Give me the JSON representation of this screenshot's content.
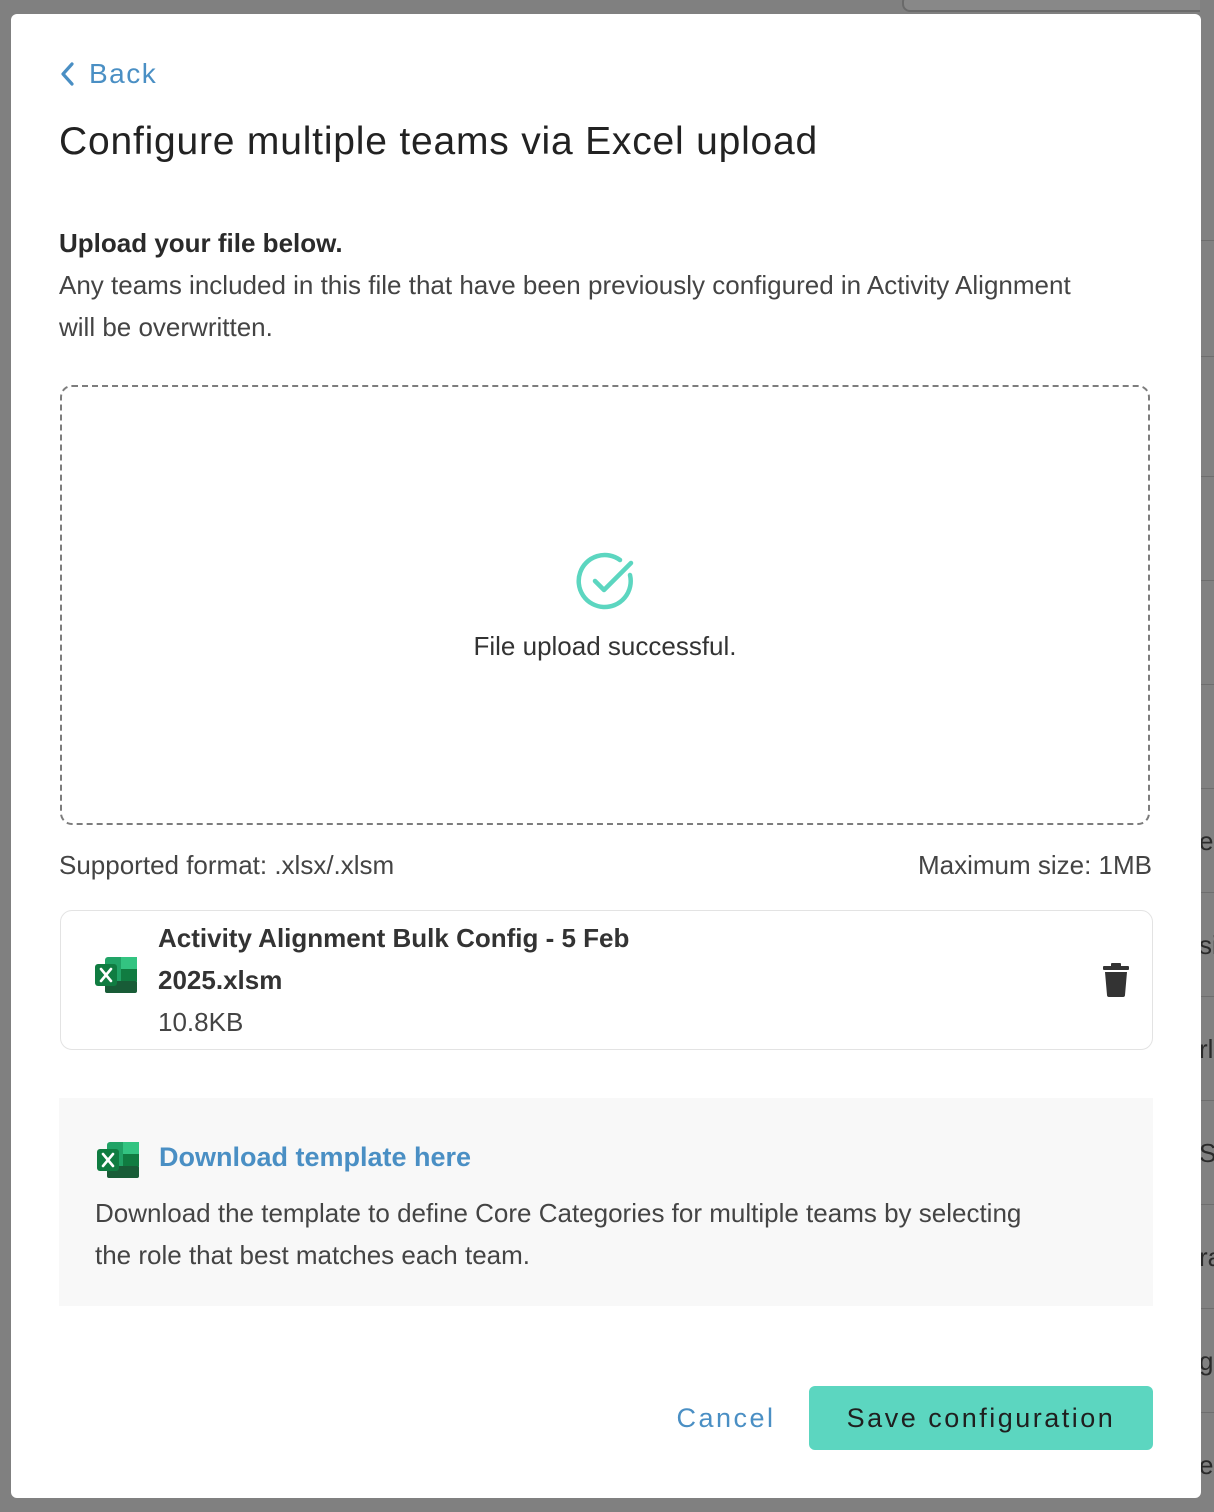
{
  "background": {
    "fragments": [
      "e",
      "si",
      "rl",
      "Se",
      "ra",
      "g",
      "e"
    ]
  },
  "modal": {
    "back_label": "Back",
    "title": "Configure multiple teams via Excel upload",
    "intro_heading": "Upload your file below.",
    "intro_text": "Any teams included in this file that have been previously configured in Activity Alignment will be overwritten.",
    "dropzone": {
      "status_icon": "check-circle-icon",
      "status_text": "File upload successful."
    },
    "supported_format": "Supported format: .xlsx/.xlsm",
    "max_size": "Maximum size: 1MB",
    "uploaded_file": {
      "icon": "excel-file-icon",
      "name": "Activity Alignment Bulk Config - 5 Feb 2025.xlsm",
      "size": "10.8KB",
      "delete_icon": "trash-icon"
    },
    "template": {
      "icon": "excel-file-icon",
      "link_label": "Download template here",
      "description": "Download the template to define Core Categories for multiple teams by selecting the role that best matches each team."
    },
    "cancel_label": "Cancel",
    "save_label": "Save configuration"
  },
  "colors": {
    "accent_link": "#4a8fc4",
    "primary_button": "#5cd6c0",
    "success_icon": "#5cd6c0",
    "excel_green": "#1d7044"
  }
}
